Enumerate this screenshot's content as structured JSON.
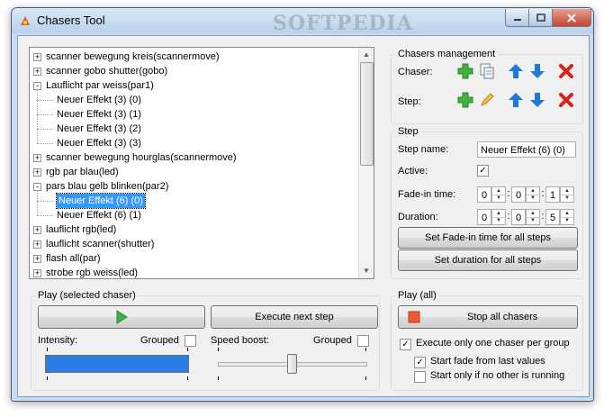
{
  "window": {
    "title": "Chasers Tool",
    "watermark": "SOFTPEDIA"
  },
  "tree": {
    "items": [
      {
        "label": "scanner bewegung kreis(scannermove)",
        "level": 0,
        "expander": "+"
      },
      {
        "label": "scanner gobo shutter(gobo)",
        "level": 0,
        "expander": "+"
      },
      {
        "label": "Lauflicht par weiss(par1)",
        "level": 0,
        "expander": "-"
      },
      {
        "label": "Neuer Effekt (3) (0)",
        "level": 1
      },
      {
        "label": "Neuer Effekt (3) (1)",
        "level": 1
      },
      {
        "label": "Neuer Effekt (3) (2)",
        "level": 1
      },
      {
        "label": "Neuer Effekt (3) (3)",
        "level": 1
      },
      {
        "label": "scanner bewegung hourglas(scannermove)",
        "level": 0,
        "expander": "+"
      },
      {
        "label": "rgb par blau(led)",
        "level": 0,
        "expander": "+"
      },
      {
        "label": "pars blau gelb blinken(par2)",
        "level": 0,
        "expander": "-"
      },
      {
        "label": "Neuer Effekt (6) (0)",
        "level": 1,
        "selected": true
      },
      {
        "label": "Neuer Effekt (6) (1)",
        "level": 1
      },
      {
        "label": "lauflicht rgb(led)",
        "level": 0,
        "expander": "+"
      },
      {
        "label": "lauflicht scanner(shutter)",
        "level": 0,
        "expander": "+"
      },
      {
        "label": "flash all(par)",
        "level": 0,
        "expander": "+"
      },
      {
        "label": "strobe rgb weiss(led)",
        "level": 0,
        "expander": "+"
      }
    ]
  },
  "chasers_management": {
    "title": "Chasers management",
    "chaser_label": "Chaser:",
    "step_label": "Step:"
  },
  "step": {
    "title": "Step",
    "step_name_label": "Step name:",
    "step_name_value": "Neuer Effekt (6) (0)",
    "active_label": "Active:",
    "active_checked": "✓",
    "fade_in_label": "Fade-in time:",
    "fade_in": [
      "0",
      "0",
      "1"
    ],
    "duration_label": "Duration:",
    "duration": [
      "0",
      "0",
      "5"
    ],
    "set_fade_all": "Set Fade-in time for all steps",
    "set_duration_all": "Set duration for all steps"
  },
  "play_selected": {
    "title": "Play (selected chaser)",
    "execute_next": "Execute next step",
    "intensity_label": "Intensity:",
    "grouped_label": "Grouped",
    "intensity_level": 1.0,
    "speed_label": "Speed boost:",
    "speed_grouped_label": "Grouped",
    "speed_level": 0.5
  },
  "play_all": {
    "title": "Play (all)",
    "stop_all": "Stop all chasers",
    "execute_one_label": "Execute only one chaser per group",
    "execute_one_checked": "✓",
    "start_fade_label": "Start fade from last values",
    "start_fade_checked": "✓",
    "start_only_label": "Start only if no other is running"
  },
  "colors": {
    "accent_green": "#3fb23f",
    "accent_blue": "#1e78d8",
    "delete_red": "#d9201c",
    "selection": "#3399ff"
  }
}
